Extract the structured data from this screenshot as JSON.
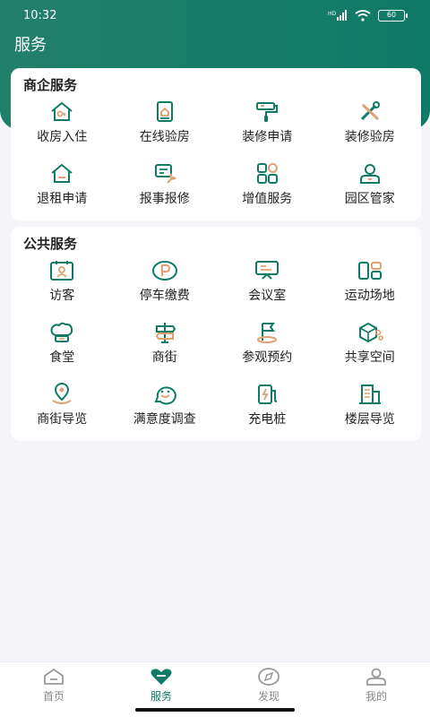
{
  "status": {
    "time": "10:32",
    "battery": "60"
  },
  "header": {
    "title": "服务"
  },
  "sections": [
    {
      "title": "商企服务",
      "items": [
        {
          "label": "收房入住",
          "icon": "house-key-icon"
        },
        {
          "label": "在线验房",
          "icon": "inspection-tablet-icon"
        },
        {
          "label": "装修申请",
          "icon": "paint-roller-icon"
        },
        {
          "label": "装修验房",
          "icon": "tools-icon"
        },
        {
          "label": "退租申请",
          "icon": "house-exit-icon"
        },
        {
          "label": "报事报修",
          "icon": "repair-wrench-icon"
        },
        {
          "label": "增值服务",
          "icon": "grid-apps-icon"
        },
        {
          "label": "园区管家",
          "icon": "butler-person-icon"
        }
      ]
    },
    {
      "title": "公共服务",
      "items": [
        {
          "label": "访客",
          "icon": "visitor-card-icon"
        },
        {
          "label": "停车缴费",
          "icon": "parking-icon"
        },
        {
          "label": "会议室",
          "icon": "meeting-screen-icon"
        },
        {
          "label": "运动场地",
          "icon": "sports-court-icon"
        },
        {
          "label": "食堂",
          "icon": "chef-hat-icon"
        },
        {
          "label": "商街",
          "icon": "signpost-icon"
        },
        {
          "label": "参观预约",
          "icon": "flag-icon"
        },
        {
          "label": "共享空间",
          "icon": "shared-cube-icon"
        },
        {
          "label": "商街导览",
          "icon": "map-pin-icon"
        },
        {
          "label": "满意度调查",
          "icon": "survey-smile-icon"
        },
        {
          "label": "充电桩",
          "icon": "charging-pile-icon"
        },
        {
          "label": "楼层导览",
          "icon": "building-icon"
        }
      ]
    }
  ],
  "tabbar": [
    {
      "label": "首页",
      "icon": "home-icon",
      "active": false
    },
    {
      "label": "服务",
      "icon": "heart-service-icon",
      "active": true
    },
    {
      "label": "发现",
      "icon": "compass-icon",
      "active": false
    },
    {
      "label": "我的",
      "icon": "profile-icon",
      "active": false
    }
  ],
  "colors": {
    "primary": "#0f7a66",
    "accent": "#e0a070",
    "background": "#f4f4f9"
  }
}
